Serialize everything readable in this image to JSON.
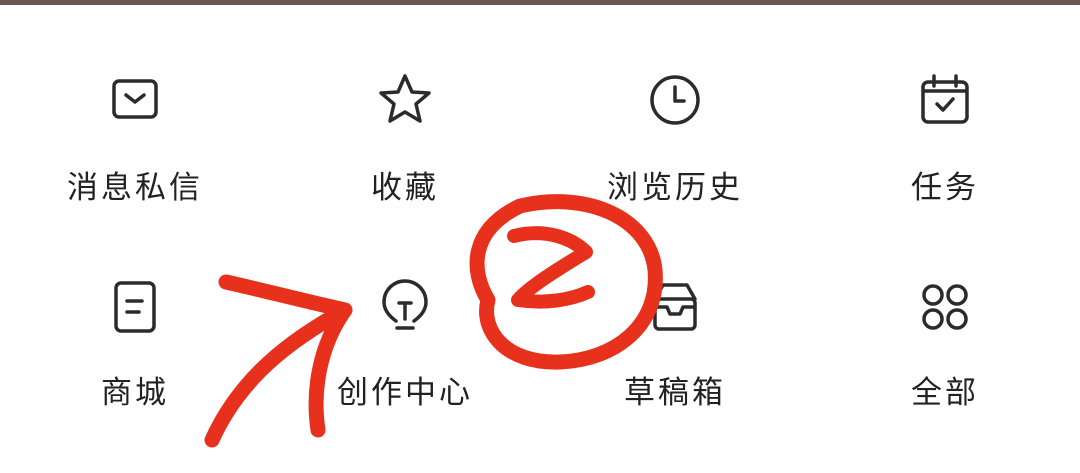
{
  "menu": {
    "items": [
      {
        "label": "消息私信",
        "icon": "mail-icon"
      },
      {
        "label": "收藏",
        "icon": "star-icon"
      },
      {
        "label": "浏览历史",
        "icon": "clock-icon"
      },
      {
        "label": "任务",
        "icon": "calendar-check-icon"
      },
      {
        "label": "商城",
        "icon": "store-list-icon"
      },
      {
        "label": "创作中心",
        "icon": "lightbulb-icon"
      },
      {
        "label": "草稿箱",
        "icon": "draft-box-icon"
      },
      {
        "label": "全部",
        "icon": "grid-dots-icon"
      }
    ]
  },
  "annotation": {
    "color": "#e8311c",
    "circled_text": "Z"
  },
  "colors": {
    "top_bar": "#6b5650",
    "icon_stroke": "#2b2b2b",
    "label_text": "#222222"
  }
}
